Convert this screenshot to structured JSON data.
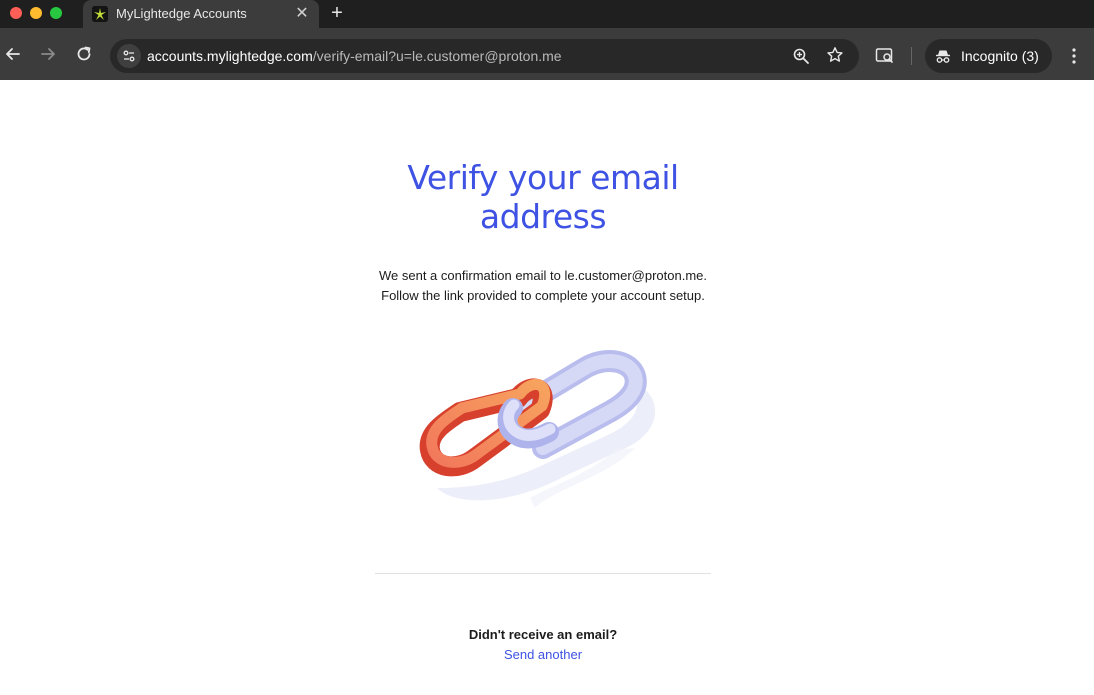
{
  "browser": {
    "tab": {
      "title": "MyLightedge Accounts",
      "close_glyph": "✕"
    },
    "new_tab_glyph": "+",
    "url": {
      "host": "accounts.mylightedge.com",
      "path": "/verify-email?u=le.customer@proton.me"
    },
    "incognito_label": "Incognito (3)",
    "icons": [
      "back-arrow-icon",
      "forward-arrow-icon",
      "reload-icon",
      "site-settings-icon",
      "zoom-icon",
      "bookmark-star-icon",
      "google-lens-icon",
      "incognito-icon",
      "kebab-menu-icon"
    ]
  },
  "page": {
    "heading_line1": "Verify your email",
    "heading_line2": "address",
    "body_line1": "We sent a confirmation email to le.customer@proton.me.",
    "body_line2": "Follow the link provided to complete your account setup.",
    "illustration": "chain-link-icon",
    "question": "Didn't receive an email?",
    "link": "Send another"
  },
  "colors": {
    "accent": "#3e52e3",
    "chrome_dark": "#1f1f1f",
    "chrome_toolbar": "#3c3c3c",
    "link_orange": "#e8502f",
    "link_lavender": "#c9cdf3"
  }
}
